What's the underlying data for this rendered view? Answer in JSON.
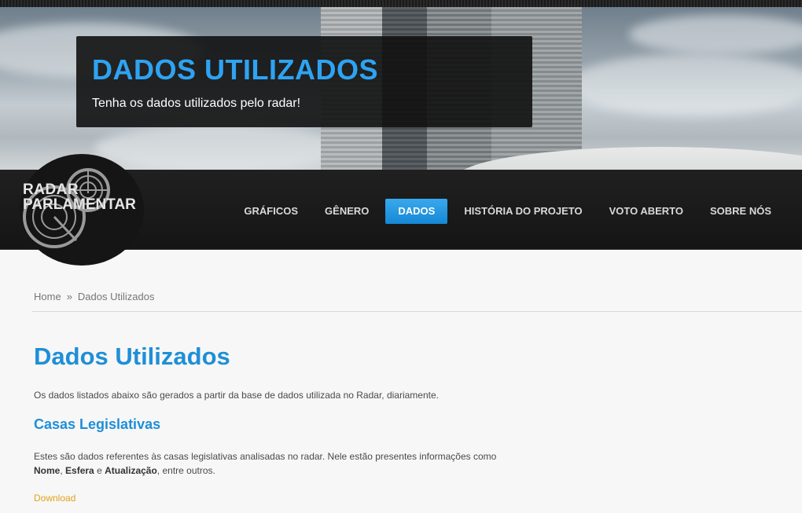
{
  "hero": {
    "title": "DADOS UTILIZADOS",
    "subtitle": "Tenha os dados utilizados pelo radar!"
  },
  "logo": {
    "line1": "RADAR",
    "line2": "PARLAMENTAR",
    "icon": "radar-icon"
  },
  "nav": {
    "items": [
      {
        "label": "GRÁFICOS"
      },
      {
        "label": "GÊNERO"
      },
      {
        "label": "DADOS",
        "active": true
      },
      {
        "label": "HISTÓRIA DO PROJETO"
      },
      {
        "label": "VOTO ABERTO"
      },
      {
        "label": "SOBRE NÓS"
      }
    ]
  },
  "breadcrumb": {
    "home": "Home",
    "separator": "»",
    "current": "Dados Utilizados"
  },
  "main": {
    "title": "Dados Utilizados",
    "intro": "Os dados listados abaixo são gerados a partir da base de dados utilizada no Radar, diariamente.",
    "section": {
      "title": "Casas Legislativas",
      "desc_pre": "Estes são dados referentes às casas legislativas analisadas no radar. Nele estão presentes informações como",
      "field1": "Nome",
      "comma": ",",
      "field2": "Esfera",
      "conj": "e",
      "field3": "Atualização",
      "desc_post": ", entre outros.",
      "download": "Download"
    }
  },
  "colors": {
    "accent": "#1e8fd7",
    "hero_title": "#2ea3f2",
    "nav_active": "#1687d4",
    "link": "#e2a21b"
  }
}
